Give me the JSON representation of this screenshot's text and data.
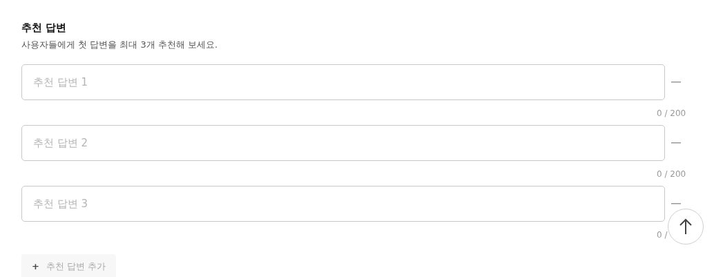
{
  "section": {
    "title": "추천 답변",
    "description": "사용자들에게 첫 답변을 최대 3개 추천해 보세요."
  },
  "answers": [
    {
      "placeholder": "추천 답변 1",
      "counter": "0 / 200"
    },
    {
      "placeholder": "추천 답변 2",
      "counter": "0 / 200"
    },
    {
      "placeholder": "추천 답변 3",
      "counter": "0 /"
    }
  ],
  "add_button": {
    "icon": "+",
    "label": "추천 답변 추가",
    "disabled": true
  }
}
